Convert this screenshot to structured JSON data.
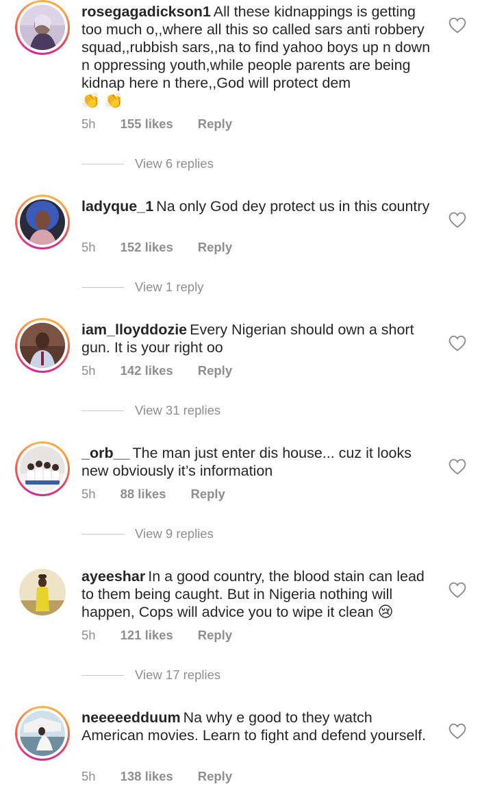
{
  "comments": [
    {
      "username": "rosegagadickson1",
      "text": "All these kidnappings is getting too much o,,where all this so called sars anti robbery squad,,rubbish sars,,na to find yahoo boys up n down n oppressing youth,while people parents are being kidnap here n there,,God will protect dem",
      "emoji": "👏 👏",
      "time": "5h",
      "likes": "155 likes",
      "reply": "Reply",
      "view_replies": "View 6 replies"
    },
    {
      "username": "ladyque_1",
      "text": "Na only God dey protect us in this country",
      "time": "5h",
      "likes": "152 likes",
      "reply": "Reply",
      "view_replies": "View 1 reply"
    },
    {
      "username": "iam_lloyddozie",
      "text": "Every Nigerian should own a short gun. It is your right  oo",
      "time": "5h",
      "likes": "142 likes",
      "reply": "Reply",
      "view_replies": "View 31 replies"
    },
    {
      "username": "_orb__",
      "text": "The man just enter dis house... cuz it looks new obviously it’s information",
      "time": "5h",
      "likes": "88 likes",
      "reply": "Reply",
      "view_replies": "View 9 replies"
    },
    {
      "username": "ayeeshar",
      "text": "In a good country, the blood stain can lead to them being caught. But in Nigeria nothing will happen, Cops will advice you to wipe it clean",
      "emoji": "😢",
      "time": "5h",
      "likes": "121 likes",
      "reply": "Reply",
      "view_replies": "View 17 replies"
    },
    {
      "username": "neeeeedduum",
      "text": "Na why e good to they watch American movies. Learn to fight and defend yourself.",
      "time": "5h",
      "likes": "138 likes",
      "reply": "Reply"
    }
  ],
  "icons": {
    "heart": "heart-outline-icon"
  },
  "colors": {
    "text": "#262626",
    "muted": "#8e8e8e",
    "story_ring": "#e4405f"
  }
}
